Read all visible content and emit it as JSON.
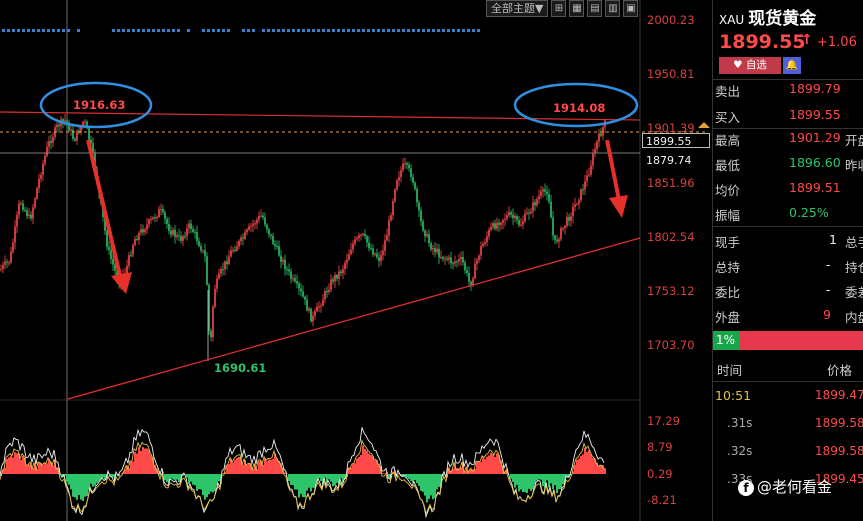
{
  "toolbar": {
    "theme_label": "全部主题▼",
    "icons": [
      "crosshair-icon",
      "grid-icon",
      "overlay-icon",
      "layout-icon",
      "window-icon"
    ]
  },
  "axis": {
    "labels": [
      "2000.23",
      "1950.81",
      "1901.39",
      "1851.96",
      "1802.54",
      "1753.12",
      "1703.70"
    ]
  },
  "current_price_box": "1899.55",
  "level_box": "1879.74",
  "indicator_axis": [
    "17.29",
    "8.79",
    "0.29",
    "-8.21"
  ],
  "annotations": {
    "left_peak": "1916.63",
    "right_peak": "1914.08",
    "low": "1690.61"
  },
  "quote": {
    "symbol": "XAU",
    "name": "现货黄金",
    "price": "1899.55",
    "arrow": "↑",
    "change": "+1.06",
    "fav_label": "自选",
    "bell_icon": "bell-icon",
    "rows": [
      {
        "label": "卖出",
        "value": "1899.79",
        "extra": ""
      },
      {
        "label": "买入",
        "value": "1899.55",
        "extra": ""
      },
      {
        "label": "最高",
        "value": "1901.29",
        "extra": "开盘"
      },
      {
        "label": "最低",
        "value": "1896.60",
        "extra": "昨收"
      },
      {
        "label": "均价",
        "value": "1899.51",
        "extra": ""
      },
      {
        "label": "振幅",
        "value": "0.25%",
        "extra": ""
      },
      {
        "label": "现手",
        "value": "1",
        "extra": "总手"
      },
      {
        "label": "总持",
        "value": "-",
        "extra": "持仓"
      },
      {
        "label": "委比",
        "value": "-",
        "extra": "委差"
      },
      {
        "label": "外盘",
        "value": "9",
        "extra": "内盘"
      }
    ],
    "bar_percent": "1%",
    "table_headers": {
      "time": "时间",
      "price": "价格"
    },
    "ticks": [
      {
        "time": "10:51",
        "price": "1899.47"
      },
      {
        "time": ".31s",
        "price": "1899.58"
      },
      {
        "time": ".32s",
        "price": "1899.58"
      },
      {
        "time": ".33s",
        "price": "1899.45"
      }
    ],
    "watermark": "@老何看金",
    "watermark_icon": "f"
  },
  "colors": {
    "up": "#ff4a4a",
    "down": "#2ec46a",
    "circle": "#2f8fe0",
    "trend": "#e03030",
    "dots": "#3a7fd0"
  },
  "chart_data": {
    "type": "candlestick",
    "ylim": [
      1690,
      2010
    ],
    "key_levels": {
      "resistance": 1916.63,
      "current": 1899.55,
      "level": 1879.74,
      "low": 1690.61,
      "right_peak": 1914.08
    },
    "indicator": {
      "type": "histogram",
      "ylim": [
        -14,
        20
      ],
      "ticks": [
        17.29,
        8.79,
        0.29,
        -8.21
      ]
    }
  }
}
